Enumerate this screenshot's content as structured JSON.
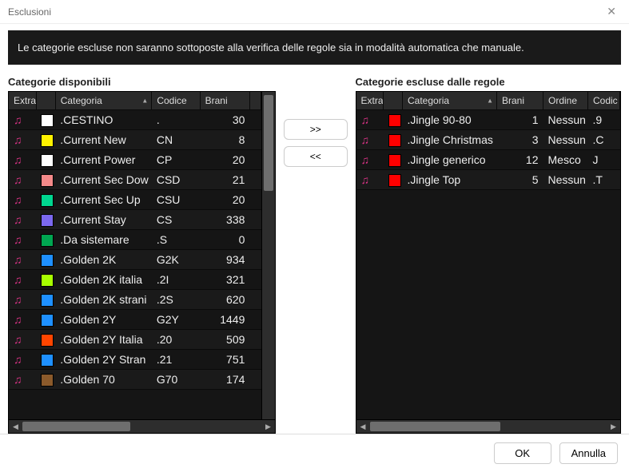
{
  "window_title": "Esclusioni",
  "info_text": "Le categorie escluse non saranno sottoposte alla verifica delle regole sia in modalità automatica che manuale.",
  "left": {
    "title": "Categorie disponibili",
    "headers": {
      "extra": "Extra",
      "categoria": "Categoria",
      "codice": "Codice",
      "brani": "Brani"
    },
    "rows": [
      {
        "color": "#ffffff",
        "categoria": ".CESTINO",
        "codice": ".",
        "brani": 30
      },
      {
        "color": "#fff200",
        "categoria": ".Current New",
        "codice": "CN",
        "brani": 8
      },
      {
        "color": "#ffffff",
        "categoria": ".Current Power",
        "codice": "CP",
        "brani": 20
      },
      {
        "color": "#f48a8a",
        "categoria": ".Current Sec Dow",
        "codice": "CSD",
        "brani": 21
      },
      {
        "color": "#00d68f",
        "categoria": ".Current Sec Up",
        "codice": "CSU",
        "brani": 20
      },
      {
        "color": "#7b68ee",
        "categoria": ".Current Stay",
        "codice": "CS",
        "brani": 338
      },
      {
        "color": "#00a651",
        "categoria": ".Da sistemare",
        "codice": ".S",
        "brani": 0
      },
      {
        "color": "#1e90ff",
        "categoria": ".Golden 2K",
        "codice": "G2K",
        "brani": 934
      },
      {
        "color": "#a8ff00",
        "categoria": ".Golden 2K italia",
        "codice": ".2I",
        "brani": 321
      },
      {
        "color": "#1e90ff",
        "categoria": ".Golden 2K strani",
        "codice": ".2S",
        "brani": 620
      },
      {
        "color": "#1e90ff",
        "categoria": ".Golden 2Y",
        "codice": "G2Y",
        "brani": 1449
      },
      {
        "color": "#ff4500",
        "categoria": ".Golden 2Y Italia",
        "codice": ".20",
        "brani": 509
      },
      {
        "color": "#1e90ff",
        "categoria": ".Golden 2Y Stran",
        "codice": ".21",
        "brani": 751
      },
      {
        "color": "#8b5a2b",
        "categoria": ".Golden 70",
        "codice": "G70",
        "brani": 174
      }
    ]
  },
  "right": {
    "title": "Categorie escluse dalle regole",
    "headers": {
      "extra": "Extra",
      "categoria": "Categoria",
      "brani": "Brani",
      "ordine": "Ordine",
      "codice": "Codic"
    },
    "rows": [
      {
        "color": "#ff0000",
        "categoria": ".Jingle 90-80",
        "brani": 1,
        "ordine": "Nessun",
        "codice": ".9"
      },
      {
        "color": "#ff0000",
        "categoria": ".Jingle Christmas",
        "brani": 3,
        "ordine": "Nessun",
        "codice": ".C"
      },
      {
        "color": "#ff0000",
        "categoria": ".Jingle generico",
        "brani": 12,
        "ordine": "Mesco",
        "codice": "J"
      },
      {
        "color": "#ff0000",
        "categoria": ".Jingle Top",
        "brani": 5,
        "ordine": "Nessun",
        "codice": ".T"
      }
    ]
  },
  "buttons": {
    "move_right": ">>",
    "move_left": "<<",
    "ok": "OK",
    "cancel": "Annulla"
  }
}
